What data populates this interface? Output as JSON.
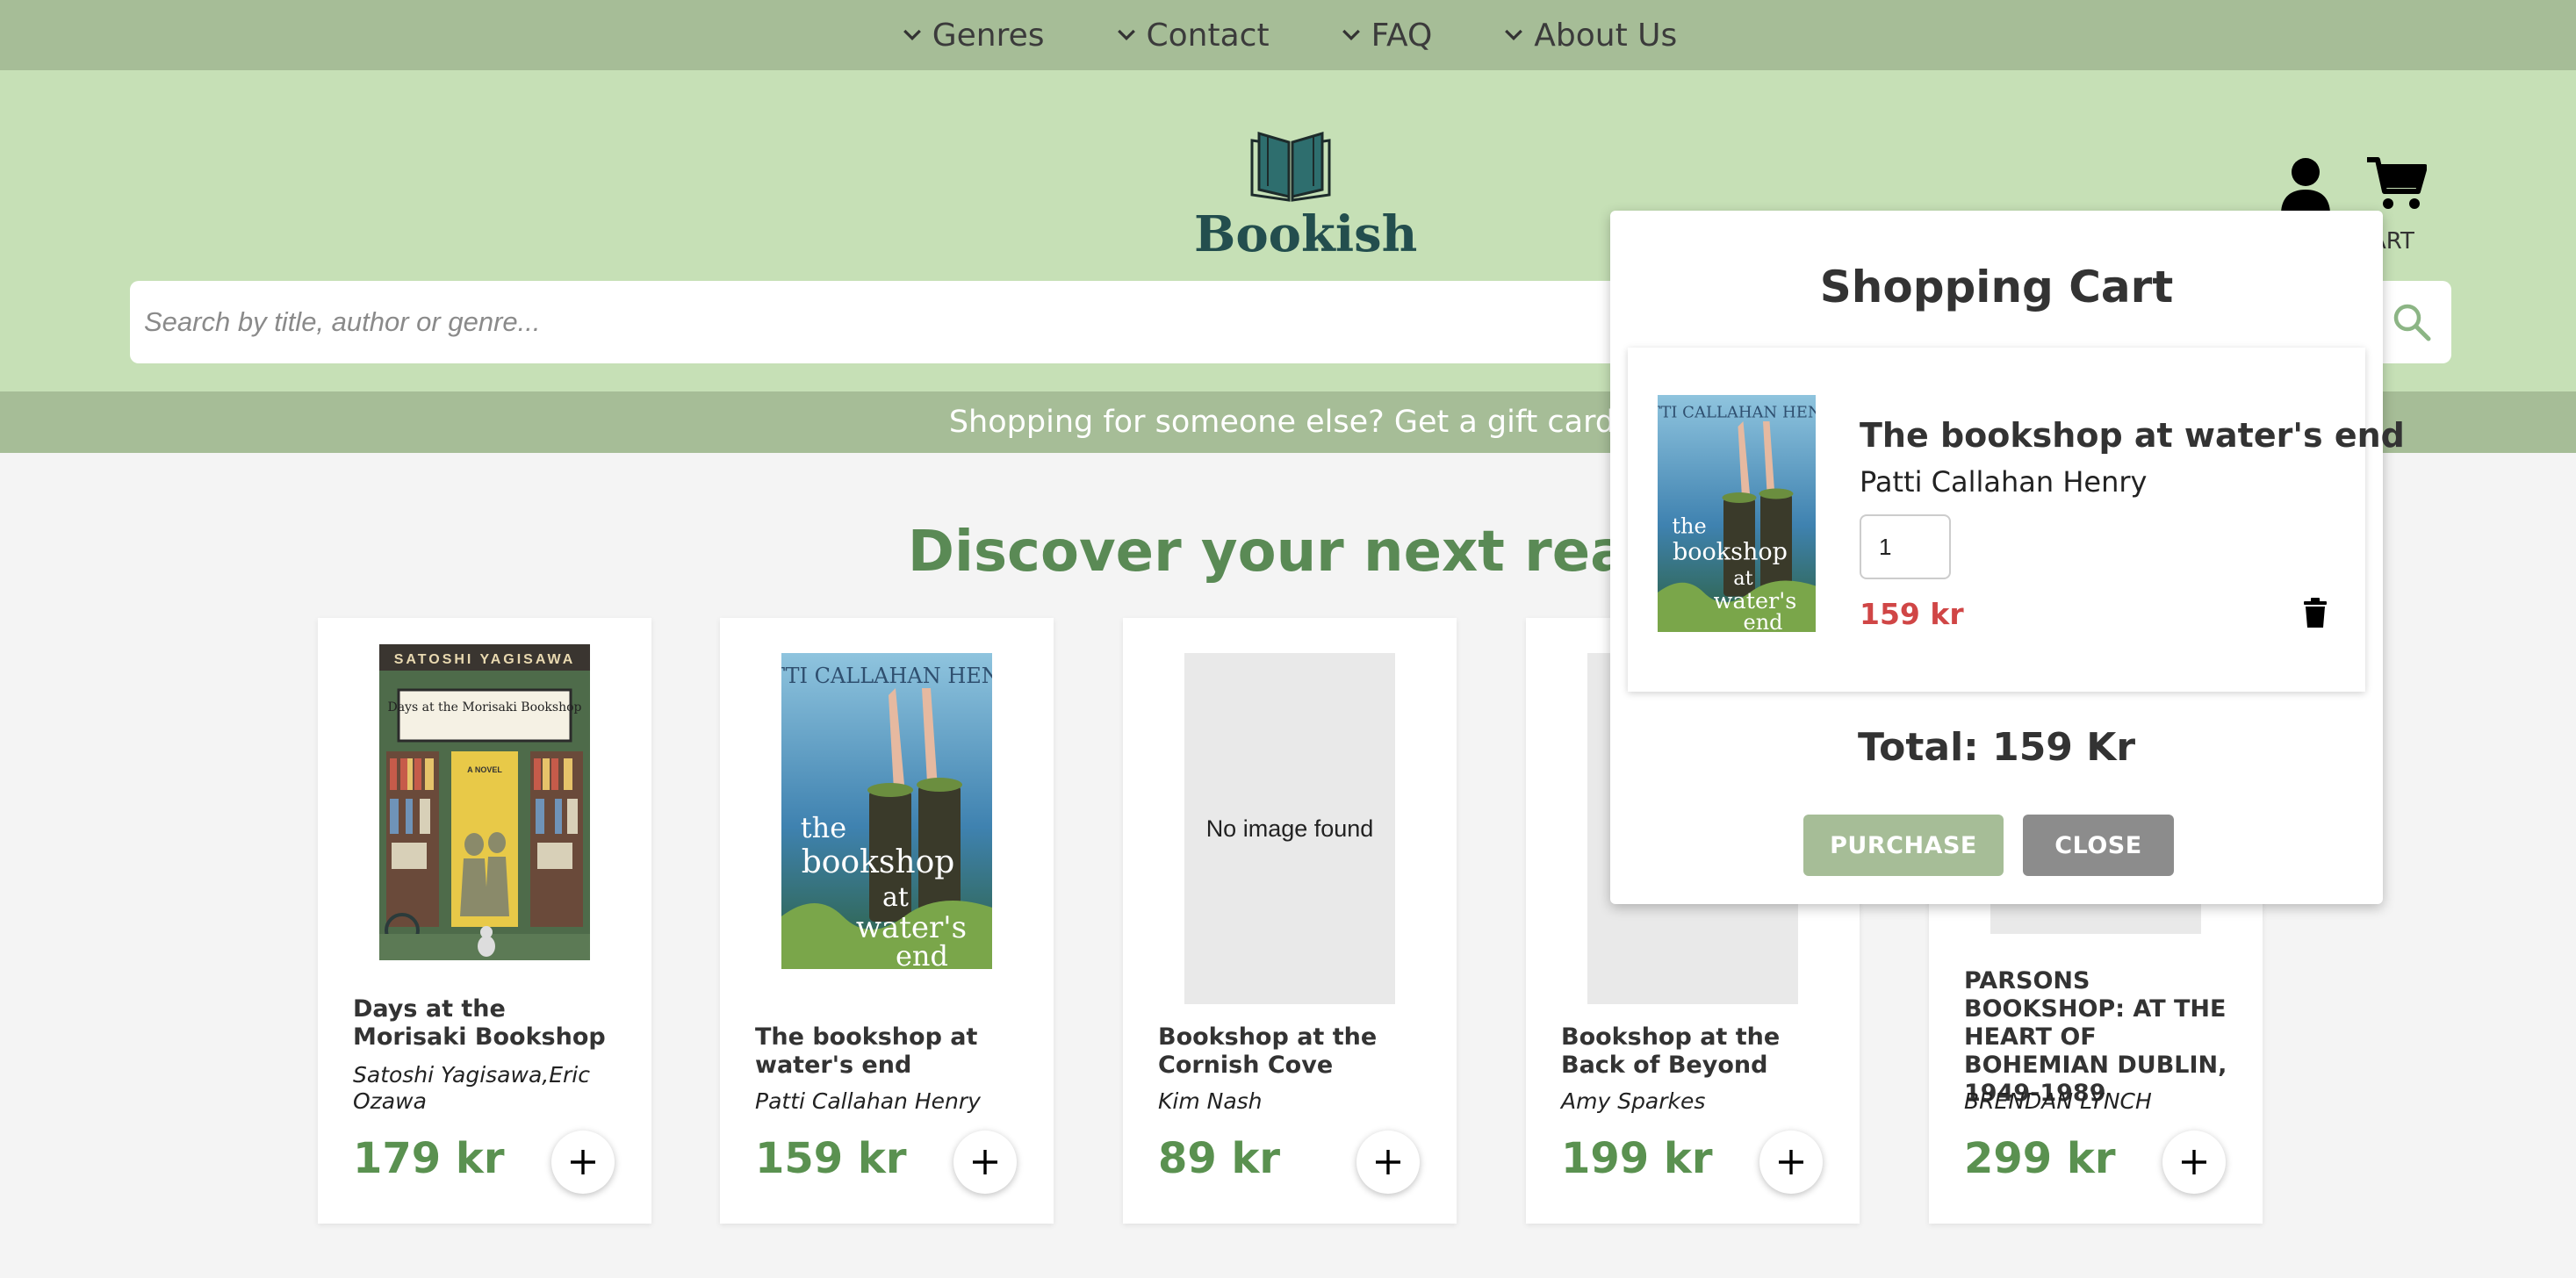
{
  "nav": {
    "items": [
      {
        "label": "Genres"
      },
      {
        "label": "Contact"
      },
      {
        "label": "FAQ"
      },
      {
        "label": "About Us"
      }
    ]
  },
  "header": {
    "logo_text": "Bookish",
    "cart_label": "ART"
  },
  "search": {
    "placeholder": "Search by title, author or genre..."
  },
  "banner": {
    "text": "Shopping for someone else? Get a gift card!"
  },
  "main": {
    "heading": "Discover your next read",
    "books": [
      {
        "title": "Days at the Morisaki Bookshop",
        "author": "Satoshi Yagisawa,Eric Ozawa",
        "price": "179 kr",
        "cover": {
          "top_text": "SATOSHI YAGISAWA",
          "sign": "Days at the Morisaki Bookshop",
          "tag": "A NOVEL"
        }
      },
      {
        "title": "The bookshop at water's end",
        "author": "Patti Callahan Henry",
        "price": "159 kr",
        "cover": {
          "author_text": "PATTI CALLAHAN HENRY",
          "title_lines": [
            "the",
            "bookshop",
            "at",
            "water's",
            "end"
          ]
        }
      },
      {
        "title": "Bookshop at the Cornish Cove",
        "author": "Kim Nash",
        "price": "89 kr",
        "no_image": "No image found"
      },
      {
        "title": "Bookshop at the Back of Beyond",
        "author": "Amy Sparkes",
        "price": "199 kr"
      },
      {
        "title": "PARSONS BOOKSHOP: AT THE HEART OF BOHEMIAN DUBLIN, 1949-1989",
        "author": "BRENDAN LYNCH",
        "price": "299 kr"
      }
    ]
  },
  "cart": {
    "title": "Shopping Cart",
    "item": {
      "title": "The bookshop at water's end",
      "author": "Patti Callahan Henry",
      "quantity": "1",
      "price": "159 kr"
    },
    "total": "Total: 159 Kr",
    "purchase_label": "PURCHASE",
    "close_label": "CLOSE"
  },
  "colors": {
    "nav_bg": "#a6bd97",
    "header_bg": "#c6e0b6",
    "accent_green": "#5a8a55",
    "price_red": "#d04646"
  }
}
